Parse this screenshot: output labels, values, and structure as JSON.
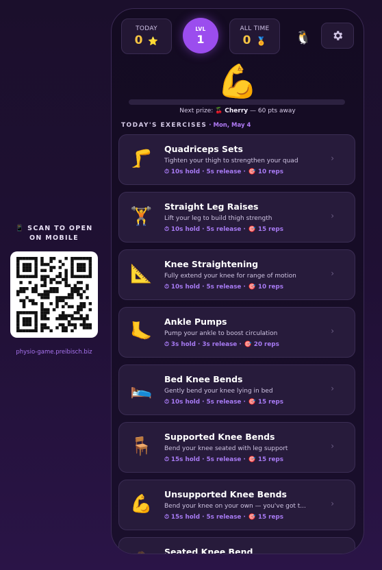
{
  "qr": {
    "title_line1": "📱 SCAN TO OPEN",
    "title_line2": "ON MOBILE",
    "url": "physio-game.preibisch.biz"
  },
  "stats": {
    "today": {
      "label": "TODAY",
      "value": "0",
      "icon": "⭐"
    },
    "level": {
      "label": "LVL",
      "value": "1"
    },
    "all_time": {
      "label": "ALL TIME",
      "value": "0",
      "icon": "🏅"
    },
    "mascot": "🐧"
  },
  "hero_icon": "💪",
  "progress_fraction": 0,
  "next_prize": {
    "prefix": "Next prize: ",
    "icon": "🍒",
    "name": "Cherry",
    "suffix": " — 60 pts away"
  },
  "section": {
    "title": "TODAY'S EXERCISES",
    "date": "· Mon, May 4"
  },
  "exercises": [
    {
      "icon": "🦵",
      "name": "Quadriceps Sets",
      "desc": "Tighten your thigh to strengthen your quad",
      "timing": "⏱ 10s hold · 5s release ·",
      "reps": "🎯 10 reps"
    },
    {
      "icon": "🏋️",
      "name": "Straight Leg Raises",
      "desc": "Lift your leg to build thigh strength",
      "timing": "⏱ 10s hold · 5s release ·",
      "reps": "🎯 15 reps"
    },
    {
      "icon": "📐",
      "name": "Knee Straightening",
      "desc": "Fully extend your knee for range of motion",
      "timing": "⏱ 10s hold · 5s release ·",
      "reps": "🎯 10 reps"
    },
    {
      "icon": "🦶",
      "name": "Ankle Pumps",
      "desc": "Pump your ankle to boost circulation",
      "timing": "⏱ 3s hold · 3s release ·",
      "reps": "🎯 20 reps"
    },
    {
      "icon": "🛌",
      "name": "Bed Knee Bends",
      "desc": "Gently bend your knee lying in bed",
      "timing": "⏱ 10s hold · 5s release ·",
      "reps": "🎯 15 reps"
    },
    {
      "icon": "🪑",
      "name": "Supported Knee Bends",
      "desc": "Bend your knee seated with leg support",
      "timing": "⏱ 15s hold · 5s release ·",
      "reps": "🎯 15 reps"
    },
    {
      "icon": "💪",
      "name": "Unsupported Knee Bends",
      "desc": "Bend your knee on your own — you've got t...",
      "timing": "⏱ 15s hold · 5s release ·",
      "reps": "🎯 15 reps"
    },
    {
      "icon": "🧘",
      "name": "Seated Knee Bend",
      "desc": "",
      "timing": "",
      "reps": ""
    }
  ]
}
